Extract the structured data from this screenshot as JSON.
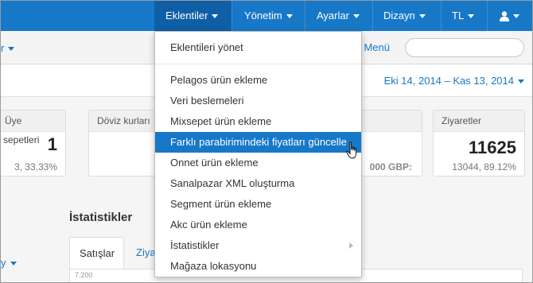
{
  "navbar": {
    "items": [
      {
        "label": "Eklentiler"
      },
      {
        "label": "Yönetim"
      },
      {
        "label": "Ayarlar"
      },
      {
        "label": "Dizayn"
      },
      {
        "label": "TL"
      }
    ],
    "user_icon": "user-icon",
    "colors": {
      "bar": "#1778c8",
      "active": "#0f5fa6"
    }
  },
  "subbar": {
    "left_label": "r",
    "menu_link": "m Menü"
  },
  "date_range": "Eki 14, 2014 – Kas 13, 2014",
  "cards": {
    "members": {
      "title": "Üye",
      "sub": "sepetleri",
      "value": "1",
      "detail": "3, 33.33%"
    },
    "currency": {
      "title": "Döviz kurları",
      "detail": "000 GBP:"
    },
    "visits": {
      "title": "Ziyaretler",
      "value": "11625",
      "detail": "13044, 89.12%"
    }
  },
  "statistics": {
    "title": "İstatistikler",
    "tabs": [
      {
        "label": "Satışlar"
      },
      {
        "label": "Ziya"
      }
    ],
    "left_dropdown": "y",
    "chart_tick": "7.200"
  },
  "dropdown": {
    "header_item": "Eklentileri yönet",
    "items": [
      {
        "label": "Pelagos ürün ekleme"
      },
      {
        "label": "Veri beslemeleri"
      },
      {
        "label": "Mixsepet ürün ekleme"
      },
      {
        "label": "Farklı parabirimindeki fiyatları güncelle"
      },
      {
        "label": "Onnet ürün ekleme"
      },
      {
        "label": "Sanalpazar XML oluşturma"
      },
      {
        "label": "Segment ürün ekleme"
      },
      {
        "label": "Akc ürün ekleme"
      },
      {
        "label": "İstatistikler"
      },
      {
        "label": "Mağaza lokasyonu"
      }
    ],
    "highlight_color": "#1778c8"
  }
}
